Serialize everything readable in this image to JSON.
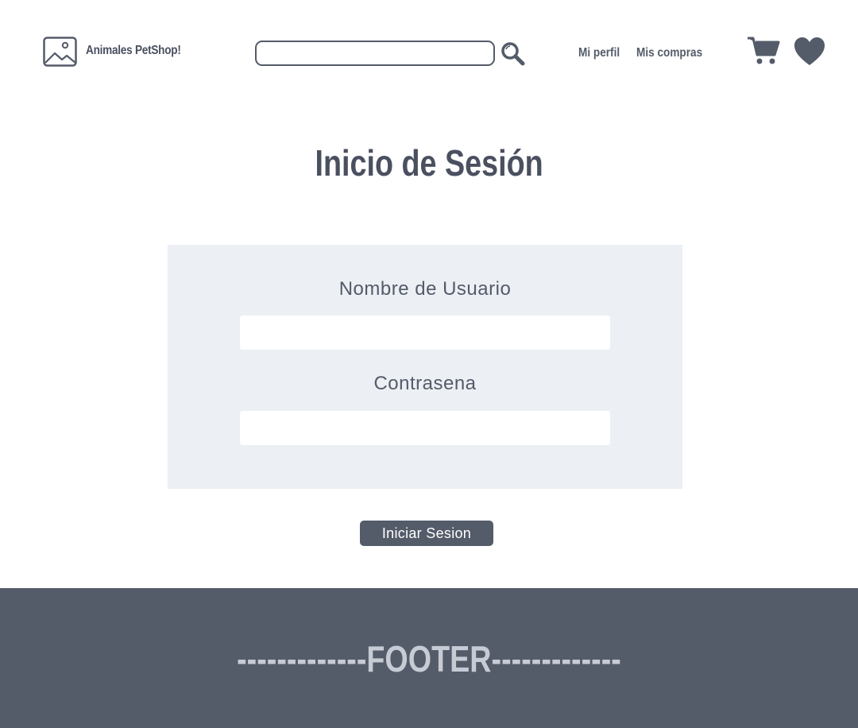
{
  "header": {
    "brand": "Animales PetShop!",
    "logo_icon": "image-placeholder-icon",
    "search": {
      "value": "",
      "placeholder": "",
      "icon": "search-icon"
    },
    "nav": [
      "Mi perfil",
      "Mis compras"
    ],
    "cart_icon": "cart-icon",
    "favorites_icon": "heart-icon"
  },
  "main": {
    "title": "Inicio de Sesión",
    "form": {
      "username_label": "Nombre de Usuario",
      "username_value": "",
      "password_label": "Contrasena",
      "password_value": "",
      "submit_label": "Iniciar Sesion"
    }
  },
  "footer": {
    "text": "-------------FOOTER-------------"
  },
  "colors": {
    "primary": "#545b69",
    "title": "#4a5060",
    "panel_bg": "#eceff4",
    "footer_text": "#c6cbd4",
    "background": "#ffffff"
  }
}
